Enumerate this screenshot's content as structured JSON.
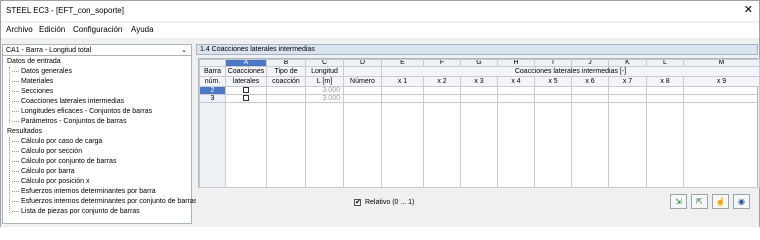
{
  "window": {
    "title": "STEEL EC3 - [EFT_con_soporte]"
  },
  "menu": [
    "Archivo",
    "Edición",
    "Configuración",
    "Ayuda"
  ],
  "case_selector": {
    "value": "CA1 - Barra - Longitud total"
  },
  "tree": {
    "group1": "Datos de entrada",
    "group1_items": [
      "Datos generales",
      "Materiales",
      "Secciones",
      "Coacciones laterales intermedias",
      "Longitudes eficaces - Conjuntos de barras",
      "Parámetros - Conjuntos de barras"
    ],
    "group2": "Resultados",
    "group2_items": [
      "Cálculo por caso de carga",
      "Cálculo por sección",
      "Cálculo por conjunto de barras",
      "Cálculo por barra",
      "Cálculo por posición x",
      "Esfuerzos internos determinantes por barra",
      "Esfuerzos internos determinantes por conjunto de barras",
      "Lista de piezas por conjunto de barras"
    ]
  },
  "panel": {
    "title": "1.4 Coacciones laterales intermedias"
  },
  "table": {
    "letters": [
      "A",
      "B",
      "C",
      "D",
      "E",
      "F",
      "G",
      "H",
      "I",
      "J",
      "K",
      "L",
      "M"
    ],
    "h_barra1": "Barra",
    "h_barra2": "núm.",
    "h_A1": "Coacciones",
    "h_A2": "laterales",
    "h_B1": "Tipo de",
    "h_B2": "coacción",
    "h_C1": "Longitud",
    "h_C2": "L [m]",
    "h_group": "Coacciones laterales intermedias [-]",
    "h_D": "Número",
    "x_cols": [
      "x 1",
      "x 2",
      "x 3",
      "x 4",
      "x 5",
      "x 6",
      "x 7",
      "x 8",
      "x 9"
    ],
    "rows": [
      {
        "num": "2",
        "length": "3.000"
      },
      {
        "num": "3",
        "length": "3.000"
      }
    ]
  },
  "bottom": {
    "relative_label": "Relativo (0 ... 1)"
  },
  "toolbar_icons": [
    "excel-export-icon",
    "excel-import-icon",
    "select-member-icon",
    "view-icon"
  ]
}
